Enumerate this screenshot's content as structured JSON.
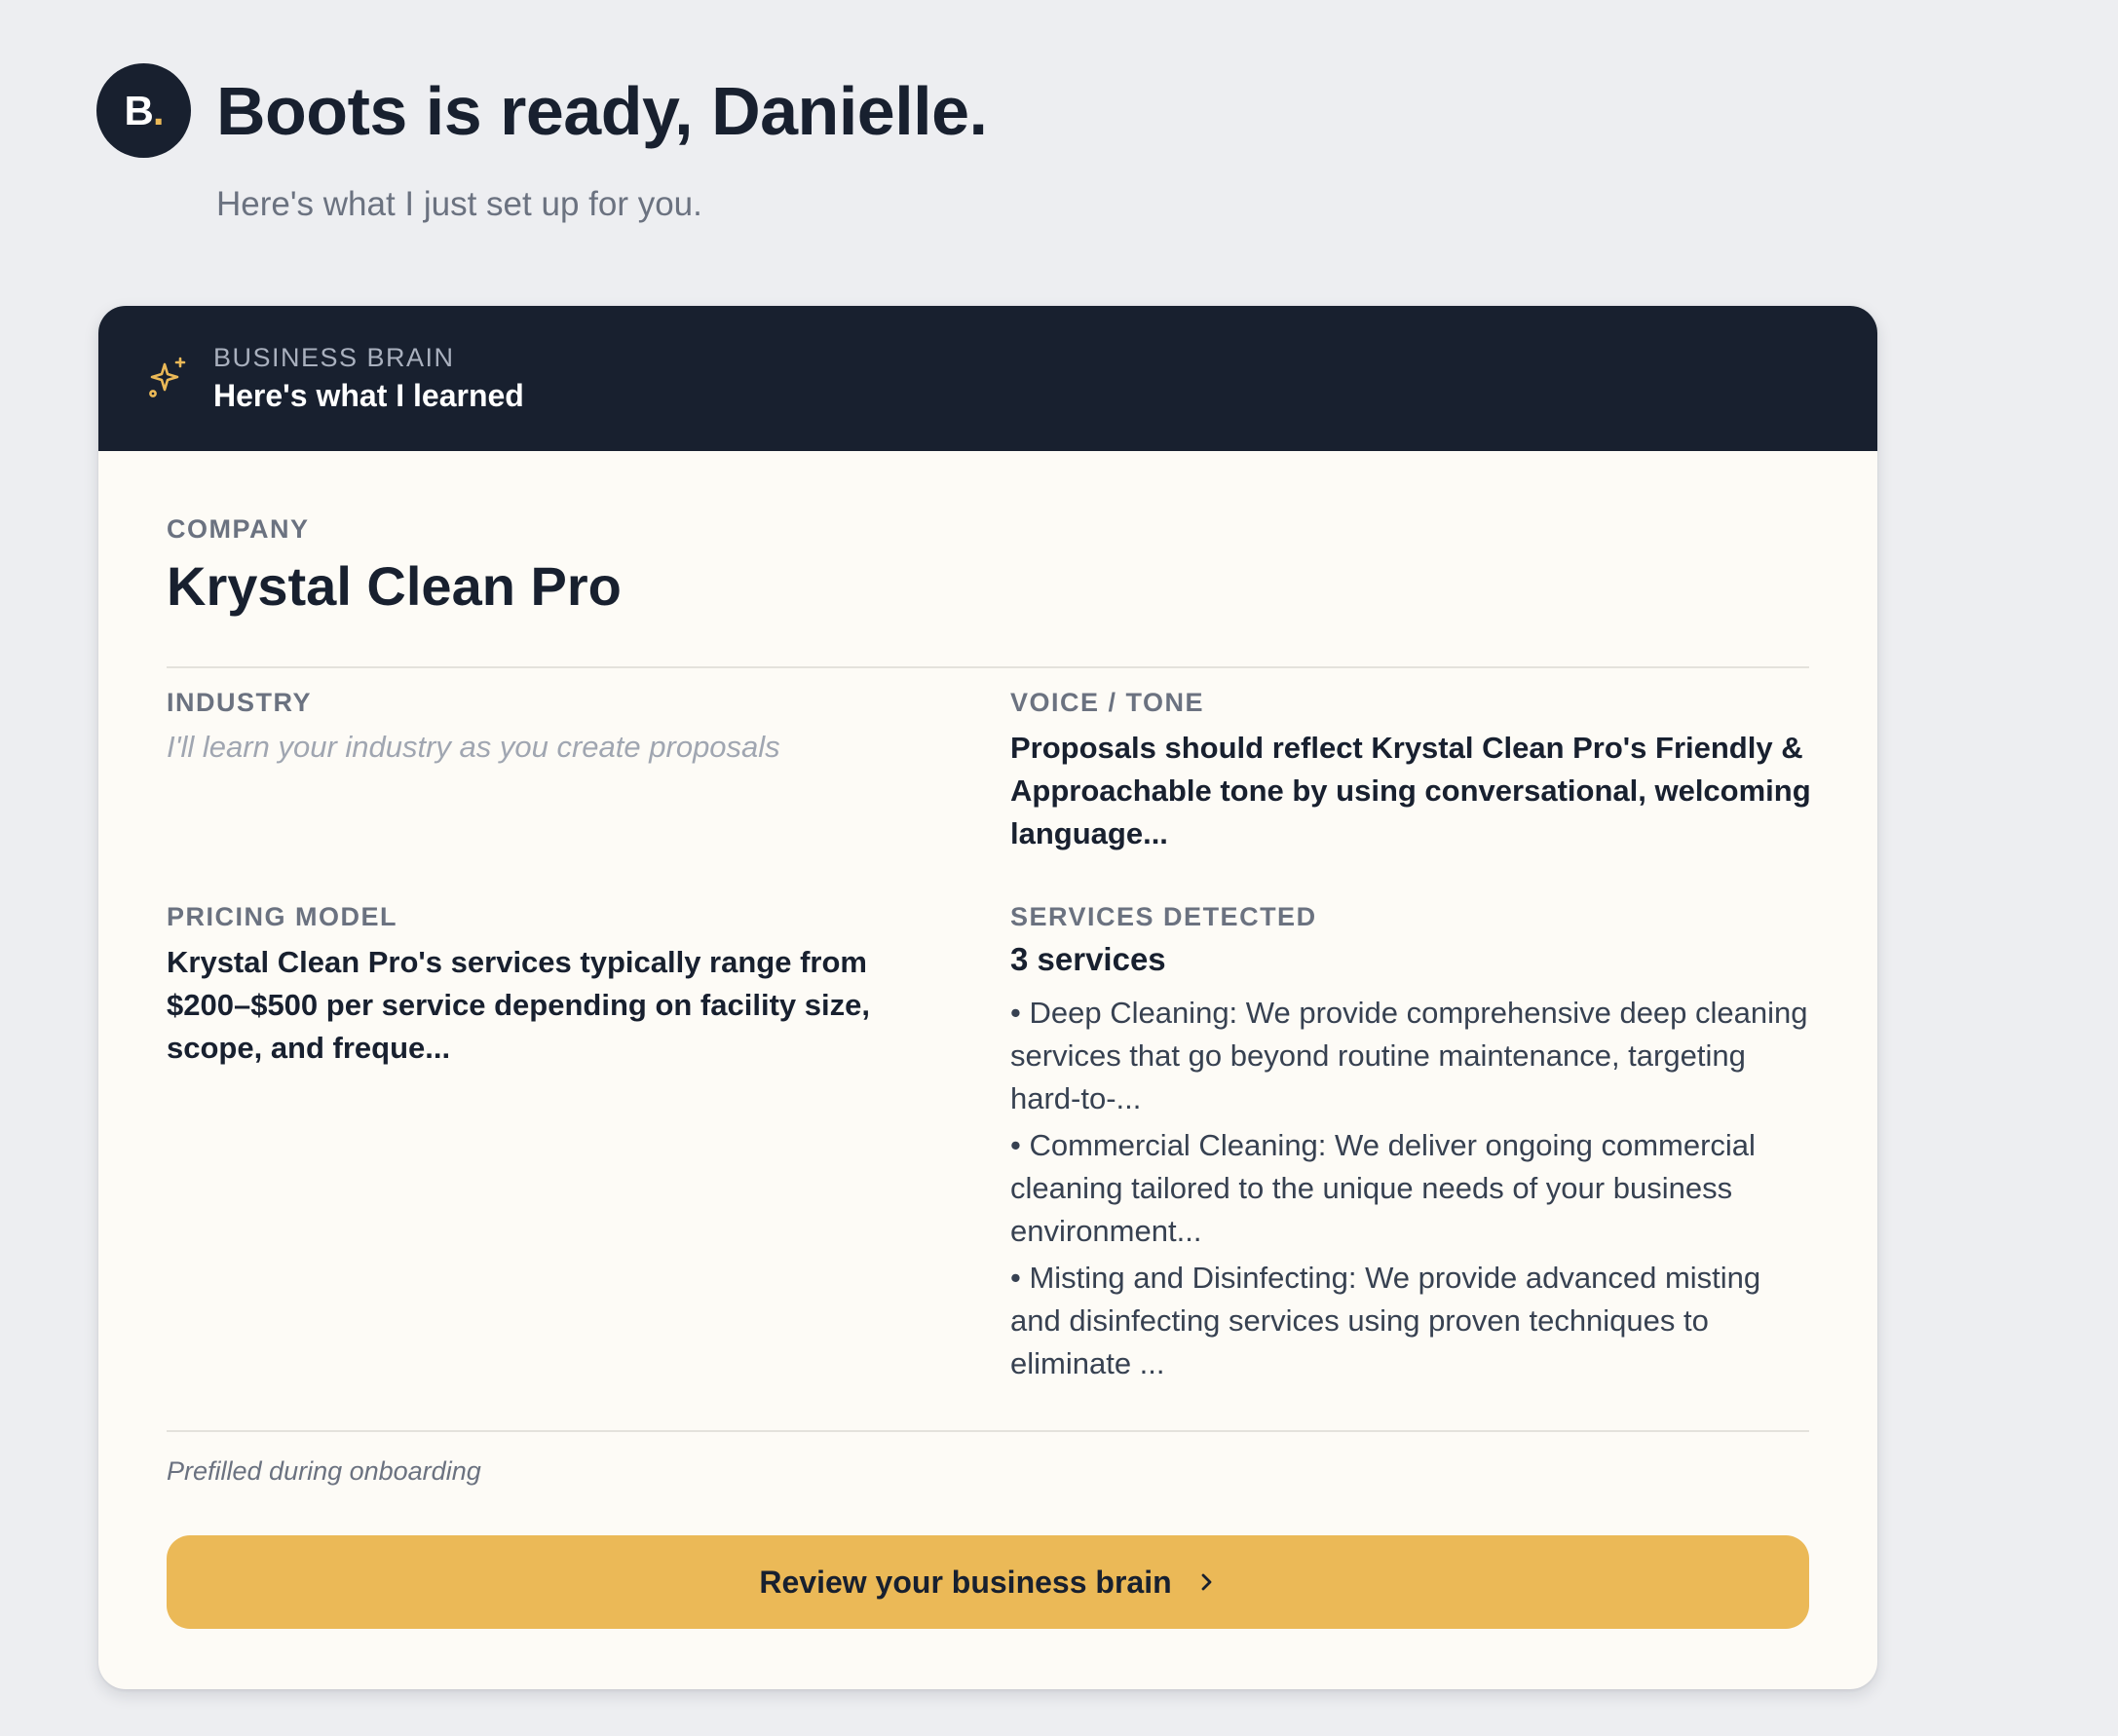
{
  "header": {
    "avatar_letter": "B",
    "avatar_dot": ".",
    "title": "Boots is ready, Danielle.",
    "subtitle": "Here's what I just set up for you."
  },
  "card": {
    "header_icon": "sparkle-icon",
    "header_label": "BUSINESS BRAIN",
    "header_title": "Here's what I learned",
    "company": {
      "label": "COMPANY",
      "value": "Krystal Clean Pro"
    },
    "industry": {
      "label": "INDUSTRY",
      "placeholder": "I'll learn your industry as you create proposals"
    },
    "voice_tone": {
      "label": "VOICE / TONE",
      "value": "Proposals should reflect Krystal Clean Pro's Friendly & Approachable tone by using conversational, welcoming language..."
    },
    "pricing_model": {
      "label": "PRICING MODEL",
      "value": "Krystal Clean Pro's services typically range from $200–$500 per service depending on facility size, scope, and freque..."
    },
    "services_detected": {
      "label": "SERVICES DETECTED",
      "count": "3 services",
      "items": [
        "• Deep Cleaning: We provide comprehensive deep cleaning services that go beyond routine maintenance, targeting hard-to-...",
        "• Commercial Cleaning: We deliver ongoing commercial cleaning tailored to the unique needs of your business environment...",
        "• Misting and Disinfecting: We provide advanced misting and disinfecting services using proven techniques to eliminate ..."
      ]
    },
    "footer_note": "Prefilled during onboarding",
    "cta_label": "Review your business brain",
    "cta_icon": "chevron-right-icon"
  },
  "colors": {
    "page_background": "#edeef1",
    "navy": "#18202f",
    "accent_gold": "#ebb957",
    "card_background": "#fdfbf6"
  }
}
